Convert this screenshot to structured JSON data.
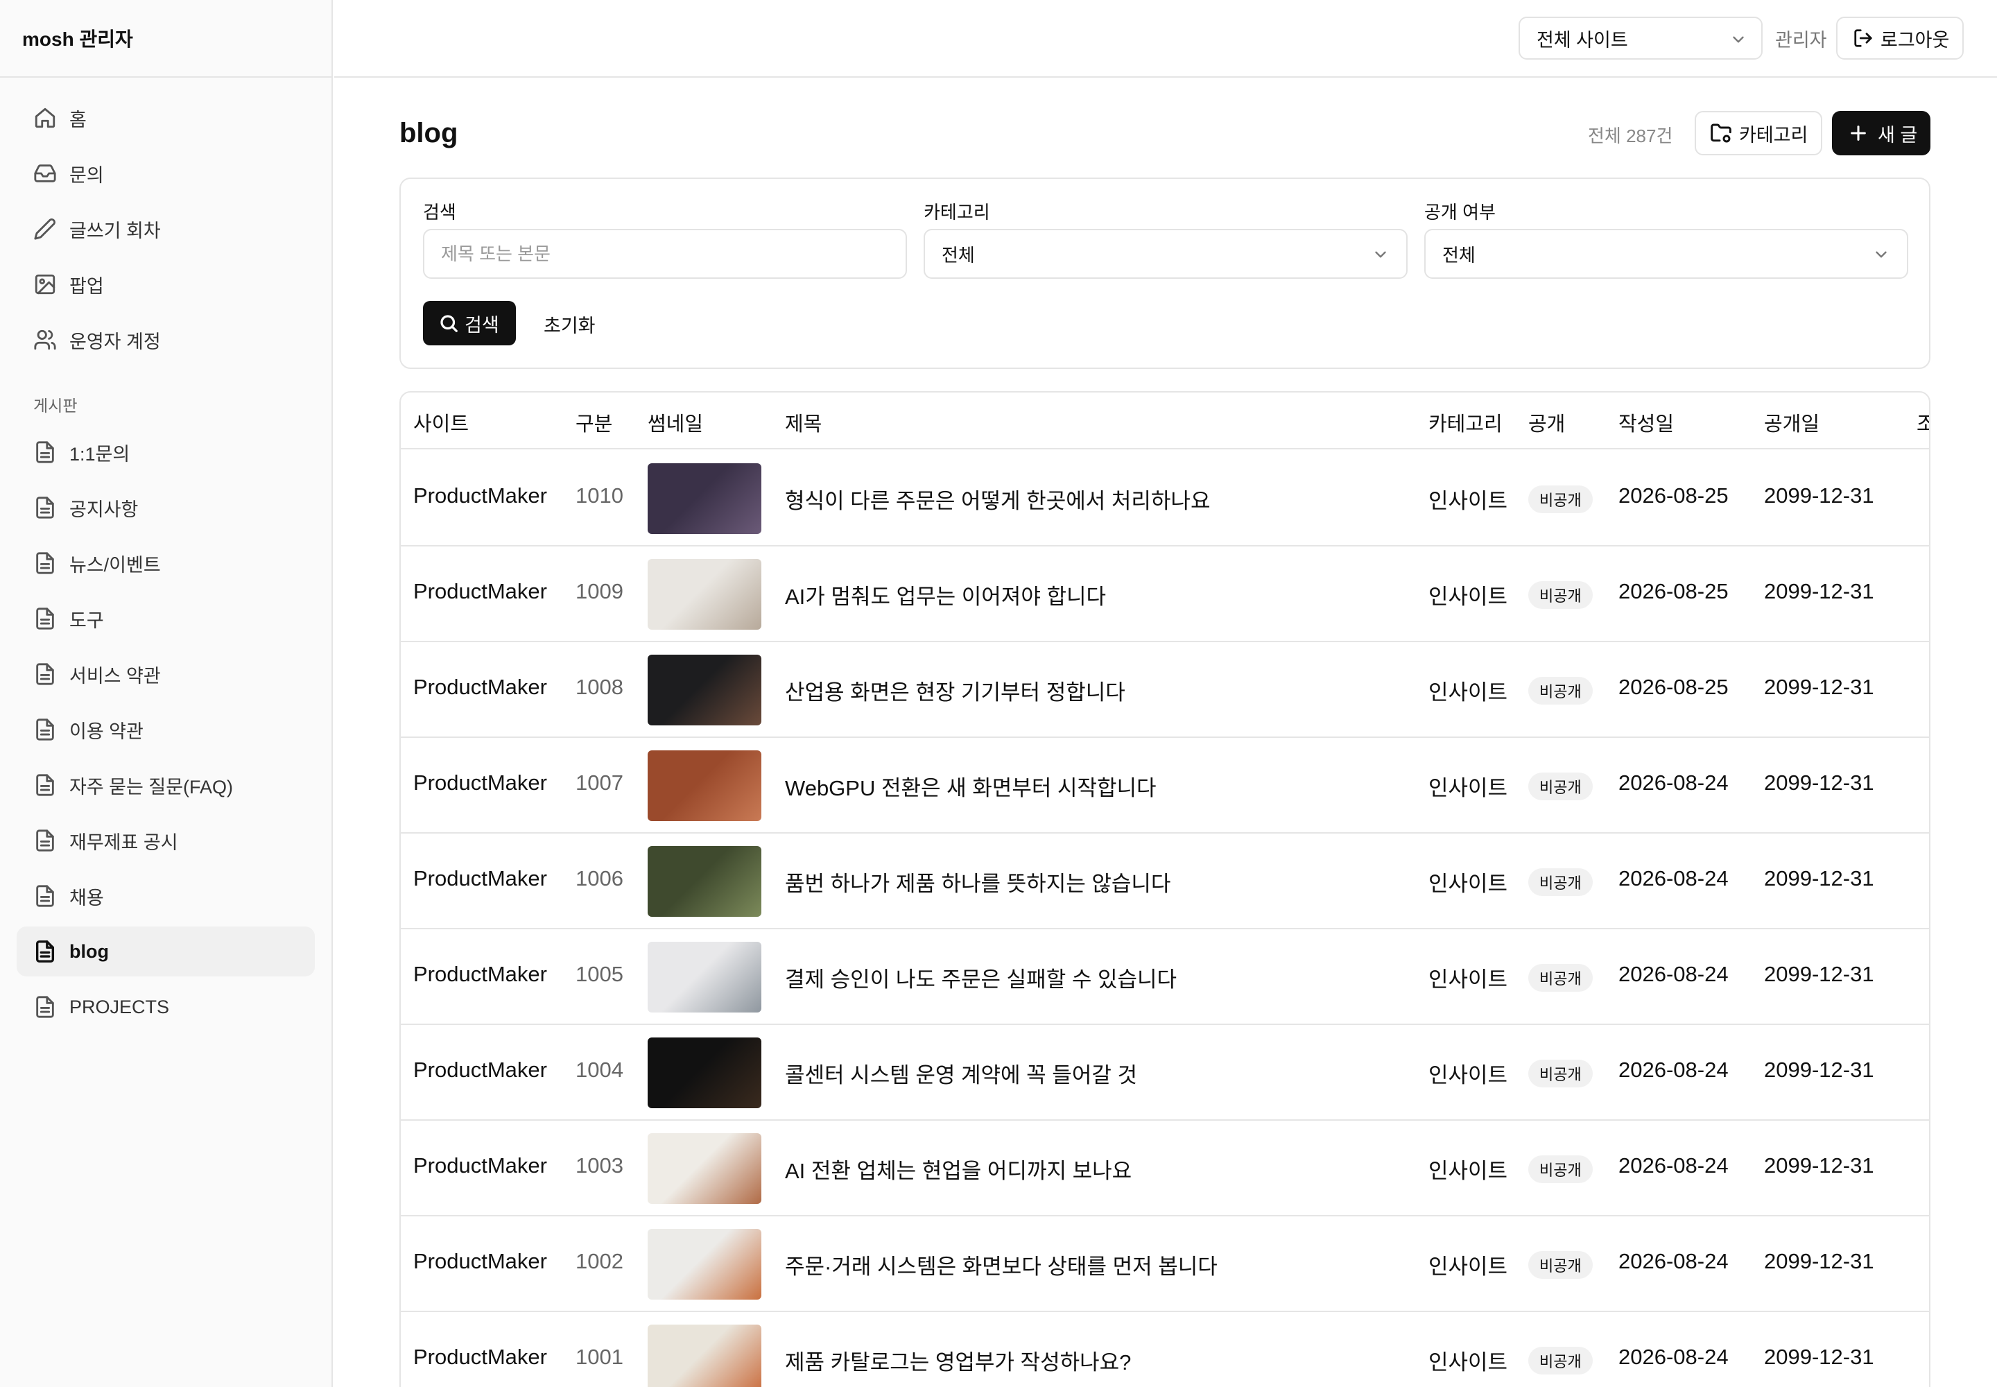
{
  "app": {
    "brand": "mosh 관리자"
  },
  "sidebar": {
    "section_label": "게시판",
    "items": [
      {
        "label": "홈",
        "icon": "home-icon"
      },
      {
        "label": "문의",
        "icon": "inbox-icon"
      },
      {
        "label": "글쓰기 회차",
        "icon": "pencil-icon"
      },
      {
        "label": "팝업",
        "icon": "image-icon"
      },
      {
        "label": "운영자 계정",
        "icon": "users-icon"
      }
    ],
    "boards": [
      {
        "label": "1:1문의",
        "icon": "document-icon"
      },
      {
        "label": "공지사항",
        "icon": "document-icon"
      },
      {
        "label": "뉴스/이벤트",
        "icon": "document-icon"
      },
      {
        "label": "도구",
        "icon": "document-icon"
      },
      {
        "label": "서비스 약관",
        "icon": "document-icon"
      },
      {
        "label": "이용 약관",
        "icon": "document-icon"
      },
      {
        "label": "자주 묻는 질문(FAQ)",
        "icon": "document-icon"
      },
      {
        "label": "재무제표 공시",
        "icon": "document-icon"
      },
      {
        "label": "채용",
        "icon": "document-icon"
      },
      {
        "label": "blog",
        "icon": "document-icon",
        "active": true
      },
      {
        "label": "PROJECTS",
        "icon": "document-icon"
      }
    ]
  },
  "topbar": {
    "site_select": "전체 사이트",
    "admin_label": "관리자",
    "logout_label": "로그아웃"
  },
  "header": {
    "title": "blog",
    "total": "전체 287건",
    "category_button": "카테고리",
    "new_button": "새 글"
  },
  "filters": {
    "search_label": "검색",
    "search_placeholder": "제목 또는 본문",
    "category_label": "카테고리",
    "category_value": "전체",
    "visibility_label": "공개 여부",
    "visibility_value": "전체",
    "search_button": "검색",
    "reset_button": "초기화"
  },
  "table": {
    "columns": [
      "사이트",
      "구분",
      "썸네일",
      "제목",
      "카테고리",
      "공개",
      "작성일",
      "공개일",
      "조"
    ],
    "rows": [
      {
        "site": "ProductMaker",
        "num": "1010",
        "title": "형식이 다른 주문은 어떻게 한곳에서 처리하나요",
        "category": "인사이트",
        "visibility": "비공개",
        "created": "2026-08-25",
        "published": "2099-12-31",
        "thumb_colors": [
          "#3a3148",
          "#6b5a78"
        ]
      },
      {
        "site": "ProductMaker",
        "num": "1009",
        "title": "AI가 멈춰도 업무는 이어져야 합니다",
        "category": "인사이트",
        "visibility": "비공개",
        "created": "2026-08-25",
        "published": "2099-12-31",
        "thumb_colors": [
          "#e9e6e1",
          "#b7a99a"
        ]
      },
      {
        "site": "ProductMaker",
        "num": "1008",
        "title": "산업용 화면은 현장 기기부터 정합니다",
        "category": "인사이트",
        "visibility": "비공개",
        "created": "2026-08-25",
        "published": "2099-12-31",
        "thumb_colors": [
          "#1d1d1f",
          "#6a4a3a"
        ]
      },
      {
        "site": "ProductMaker",
        "num": "1007",
        "title": "WebGPU 전환은 새 화면부터 시작합니다",
        "category": "인사이트",
        "visibility": "비공개",
        "created": "2026-08-24",
        "published": "2099-12-31",
        "thumb_colors": [
          "#9a4a2c",
          "#c97a55"
        ]
      },
      {
        "site": "ProductMaker",
        "num": "1006",
        "title": "품번 하나가 제품 하나를 뜻하지는 않습니다",
        "category": "인사이트",
        "visibility": "비공개",
        "created": "2026-08-24",
        "published": "2099-12-31",
        "thumb_colors": [
          "#3f4a2e",
          "#7c8a5a"
        ]
      },
      {
        "site": "ProductMaker",
        "num": "1005",
        "title": "결제 승인이 나도 주문은 실패할 수 있습니다",
        "category": "인사이트",
        "visibility": "비공개",
        "created": "2026-08-24",
        "published": "2099-12-31",
        "thumb_colors": [
          "#e8e8ea",
          "#8f979f"
        ]
      },
      {
        "site": "ProductMaker",
        "num": "1004",
        "title": "콜센터 시스템 운영 계약에 꼭 들어갈 것",
        "category": "인사이트",
        "visibility": "비공개",
        "created": "2026-08-24",
        "published": "2099-12-31",
        "thumb_colors": [
          "#111111",
          "#3a2a1e"
        ]
      },
      {
        "site": "ProductMaker",
        "num": "1003",
        "title": "AI 전환 업체는 현업을 어디까지 보나요",
        "category": "인사이트",
        "visibility": "비공개",
        "created": "2026-08-24",
        "published": "2099-12-31",
        "thumb_colors": [
          "#efece6",
          "#b06a45"
        ]
      },
      {
        "site": "ProductMaker",
        "num": "1002",
        "title": "주문·거래 시스템은 화면보다 상태를 먼저 봅니다",
        "category": "인사이트",
        "visibility": "비공개",
        "created": "2026-08-24",
        "published": "2099-12-31",
        "thumb_colors": [
          "#ecebe8",
          "#c9703f"
        ]
      },
      {
        "site": "ProductMaker",
        "num": "1001",
        "title": "제품 카탈로그는 영업부가 작성하나요?",
        "category": "인사이트",
        "visibility": "비공개",
        "created": "2026-08-24",
        "published": "2099-12-31",
        "thumb_colors": [
          "#e9e4da",
          "#c96a3a"
        ]
      }
    ]
  }
}
